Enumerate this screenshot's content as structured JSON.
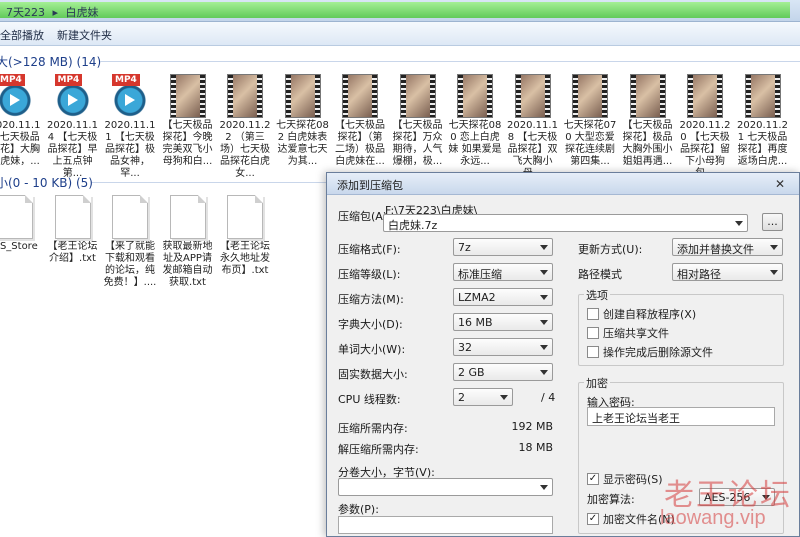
{
  "explorer": {
    "address": {
      "root": "7天223",
      "separator": "▸",
      "current": "白虎妹"
    },
    "toolbar": {
      "play_all": "全部播放",
      "new_folder": "新建文件夹"
    },
    "group_large": "大(>128 MB) (14)",
    "group_small": "小(0 - 10 KB) (5)",
    "videos": [
      {
        "type": "mp4",
        "label": "2020.11.12 七天极品探花】大胸白虎妹，..."
      },
      {
        "type": "mp4",
        "label": "2020.11.14 【七天极品探花】早上五点钟第..."
      },
      {
        "type": "mp4",
        "label": "2020.11.11 【七天极品探花】极品女神，罕..."
      },
      {
        "type": "video",
        "label": "【七天极品探花】今晚完美双飞小母狗和白..."
      },
      {
        "type": "video",
        "label": "2020.11.22 （第三场）七天极品探花白虎女..."
      },
      {
        "type": "video",
        "label": "七天探花082 白虎妹表达爱意七天为其..."
      },
      {
        "type": "video",
        "label": "【七天极品探花】（第二场）极品白虎妹在..."
      },
      {
        "type": "video",
        "label": "【七天极品探花】万众期待，人气爆棚，极..."
      },
      {
        "type": "video",
        "label": "七天探花080 恋上白虎妹 如果爱是永远..."
      },
      {
        "type": "video",
        "label": "2020.11.18 【七天极品探花】双飞大胸小母..."
      },
      {
        "type": "video",
        "label": "七天探花070 大型恋爱探花连续剧 第四集..."
      },
      {
        "type": "video",
        "label": "【七天极品探花】极品大胸外围小姐姐再遇..."
      },
      {
        "type": "video",
        "label": "2020.11.20 【七天极品探花】留下小母狗包..."
      },
      {
        "type": "video",
        "label": "2020.11.21 七天极品探花】再度返场白虎..."
      }
    ],
    "docs": [
      {
        "label": "DS_Store"
      },
      {
        "label": "【老王论坛介绍】.txt"
      },
      {
        "label": "【来了就能下载和观看的论坛，纯免费！】...."
      },
      {
        "label": "获取最新地址及APP请发邮箱自动获取.txt"
      },
      {
        "label": "【老王论坛永久地址发布页】.txt"
      }
    ]
  },
  "dialog": {
    "title": "添加到压缩包",
    "close": "✕",
    "archive_label": "压缩包(A)",
    "archive_path": "F:\\7天223\\白虎妹\\",
    "archive_name": "白虎妹.7z",
    "browse": "...",
    "format_label": "压缩格式(F):",
    "format_value": "7z",
    "level_label": "压缩等级(L):",
    "level_value": "标准压缩",
    "method_label": "压缩方法(M):",
    "method_value": "LZMA2",
    "dict_label": "字典大小(D):",
    "dict_value": "16 MB",
    "word_label": "单词大小(W):",
    "word_value": "32",
    "solid_label": "固实数据大小:",
    "solid_value": "2 GB",
    "cpu_label": "CPU 线程数:",
    "cpu_value": "2",
    "cpu_total": "/ 4",
    "mem_comp_label": "压缩所需内存:",
    "mem_comp_value": "192 MB",
    "mem_decomp_label": "解压缩所需内存:",
    "mem_decomp_value": "18 MB",
    "split_label": "分卷大小，字节(V):",
    "split_value": "",
    "params_label": "参数(P):",
    "params_value": "",
    "update_label": "更新方式(U):",
    "update_value": "添加并替换文件",
    "path_label": "路径模式",
    "path_value": "相对路径",
    "options_title": "选项",
    "opt_sfx": "创建自释放程序(X)",
    "opt_shared": "压缩共享文件",
    "opt_delete": "操作完成后删除源文件",
    "encrypt_title": "加密",
    "password_label": "输入密码:",
    "password_value": "上老王论坛当老王",
    "show_password": "显示密码(S)",
    "show_password_check": "✓",
    "enc_method_label": "加密算法:",
    "enc_method_value": "AES-256",
    "encrypt_names": "加密文件名(N)",
    "encrypt_names_check": "✓"
  },
  "watermark": {
    "text": "老王论坛",
    "url": "laowang.vip"
  },
  "colors": {
    "accent": "#1e3f8a",
    "watermark": "#d63c3c",
    "progress": "#57c94a"
  }
}
